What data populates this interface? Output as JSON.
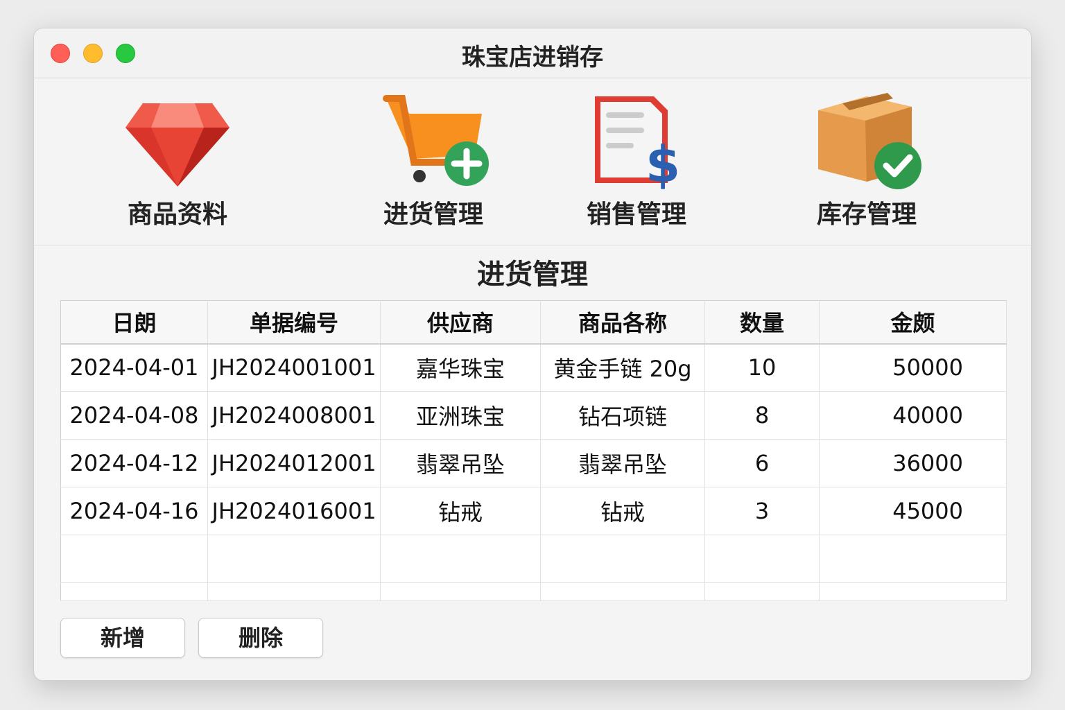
{
  "window": {
    "title": "珠宝店进销存"
  },
  "toolbar": [
    {
      "label": "商品资料",
      "icon": "gem-icon"
    },
    {
      "label": "进货管理",
      "icon": "cart-add-icon"
    },
    {
      "label": "销售管理",
      "icon": "invoice-dollar-icon"
    },
    {
      "label": "库存管理",
      "icon": "box-check-icon"
    }
  ],
  "section_title": "进货管理",
  "table": {
    "headers": [
      "日朗",
      "单据编号",
      "供应商",
      "商品各称",
      "数量",
      "金颇"
    ],
    "rows": [
      [
        "2024-04-01",
        "JH2024001001",
        "嘉华珠宝",
        "黄金手链 20g",
        "10",
        "50000"
      ],
      [
        "2024-04-08",
        "JH2024008001",
        "亚洲珠宝",
        "钻石项链",
        "8",
        "40000"
      ],
      [
        "2024-04-12",
        "JH2024012001",
        "翡翠吊坠",
        "翡翠吊坠",
        "6",
        "36000"
      ],
      [
        "2024-04-16",
        "JH2024016001",
        "钻戒",
        "钻戒",
        "3",
        "45000"
      ]
    ]
  },
  "buttons": {
    "add": "新增",
    "delete": "删除"
  }
}
